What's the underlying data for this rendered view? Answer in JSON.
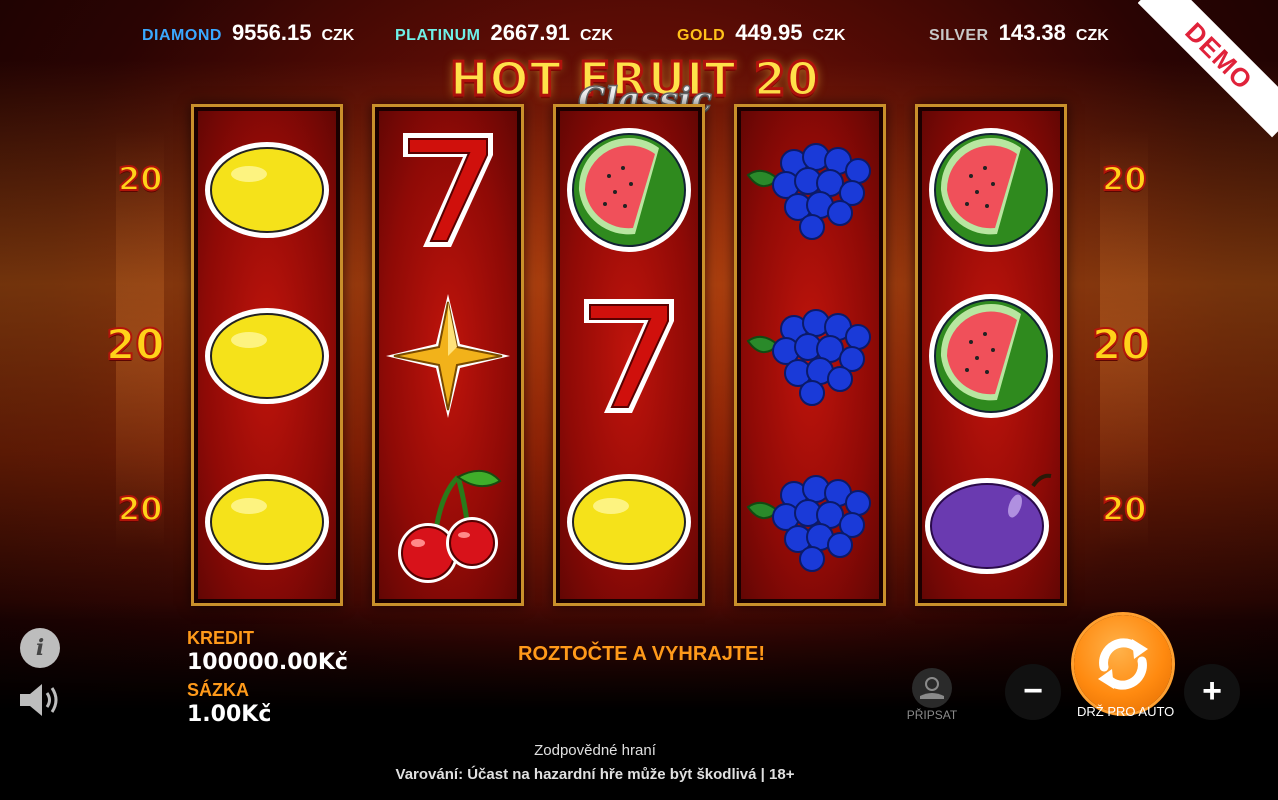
{
  "jackpots": [
    {
      "name": "DIAMOND",
      "value": "9556.15",
      "currency": "CZK",
      "color": "#3aa8ff"
    },
    {
      "name": "PLATINUM",
      "value": "2667.91",
      "currency": "CZK",
      "color": "#6ff0e8"
    },
    {
      "name": "GOLD",
      "value": "449.95",
      "currency": "CZK",
      "color": "#ffc21a"
    },
    {
      "name": "SILVER",
      "value": "143.38",
      "currency": "CZK",
      "color": "#c8c8c8"
    }
  ],
  "demo_label": "DEMO",
  "logo": {
    "main": "HOT FRUIT 20",
    "sub": "Classic"
  },
  "lines": {
    "left": [
      "20",
      "20",
      "20"
    ],
    "right": [
      "20",
      "20",
      "20"
    ]
  },
  "reels": [
    [
      "lemon",
      "lemon",
      "lemon"
    ],
    [
      "seven",
      "star",
      "cherry"
    ],
    [
      "watermelon",
      "seven",
      "lemon"
    ],
    [
      "grapes",
      "grapes",
      "grapes"
    ],
    [
      "watermelon",
      "watermelon",
      "plum"
    ]
  ],
  "credit": {
    "label": "KREDIT",
    "value": "100000.00Kč"
  },
  "bet": {
    "label": "SÁZKA",
    "value": "1.00Kč"
  },
  "message": "ROZTOČTE A VYHRAJTE!",
  "buttons": {
    "info": "i",
    "collect": "PŘIPSAT",
    "minus": "−",
    "plus": "+",
    "autoplay_hint": "DRŽ PRO AUTO"
  },
  "footer": {
    "responsible": "Zodpovědné hraní",
    "warning": "Varování: Účast na hazardní hře může být škodlivá | 18+"
  },
  "colors": {
    "accent_orange": "#ff9a1a",
    "reel_frame": "#c9902b",
    "reel_bg": "#a50e08"
  }
}
